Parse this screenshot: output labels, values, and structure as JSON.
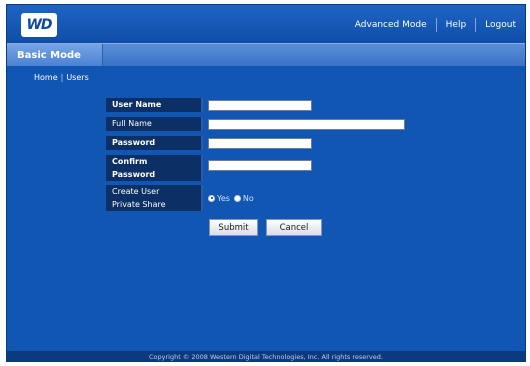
{
  "header": {
    "logo_text": "WD",
    "nav": [
      "Advanced Mode",
      "Help",
      "Logout"
    ]
  },
  "tab": {
    "label": "Basic Mode"
  },
  "breadcrumb": {
    "home": "Home",
    "current": "Users"
  },
  "form": {
    "user_name_label": "User Name",
    "full_name_label": "Full Name",
    "password_label": "Password",
    "confirm_label_line1": "Confirm",
    "confirm_label_line2": "Password",
    "share_label_line1": "Create User",
    "share_label_line2": "Private Share",
    "share_yes": "Yes",
    "share_no": "No",
    "share_selected": "Yes",
    "user_name_value": "",
    "full_name_value": "",
    "password_value": "",
    "confirm_value": ""
  },
  "buttons": {
    "submit": "Submit",
    "cancel": "Cancel"
  },
  "footer": {
    "copyright": "Copyright © 2008 Western Digital Technologies, Inc. All rights reserved."
  },
  "colors": {
    "background": "#1256b3",
    "label_bg": "#0c2f66",
    "footer_bg": "#0c3a80"
  }
}
